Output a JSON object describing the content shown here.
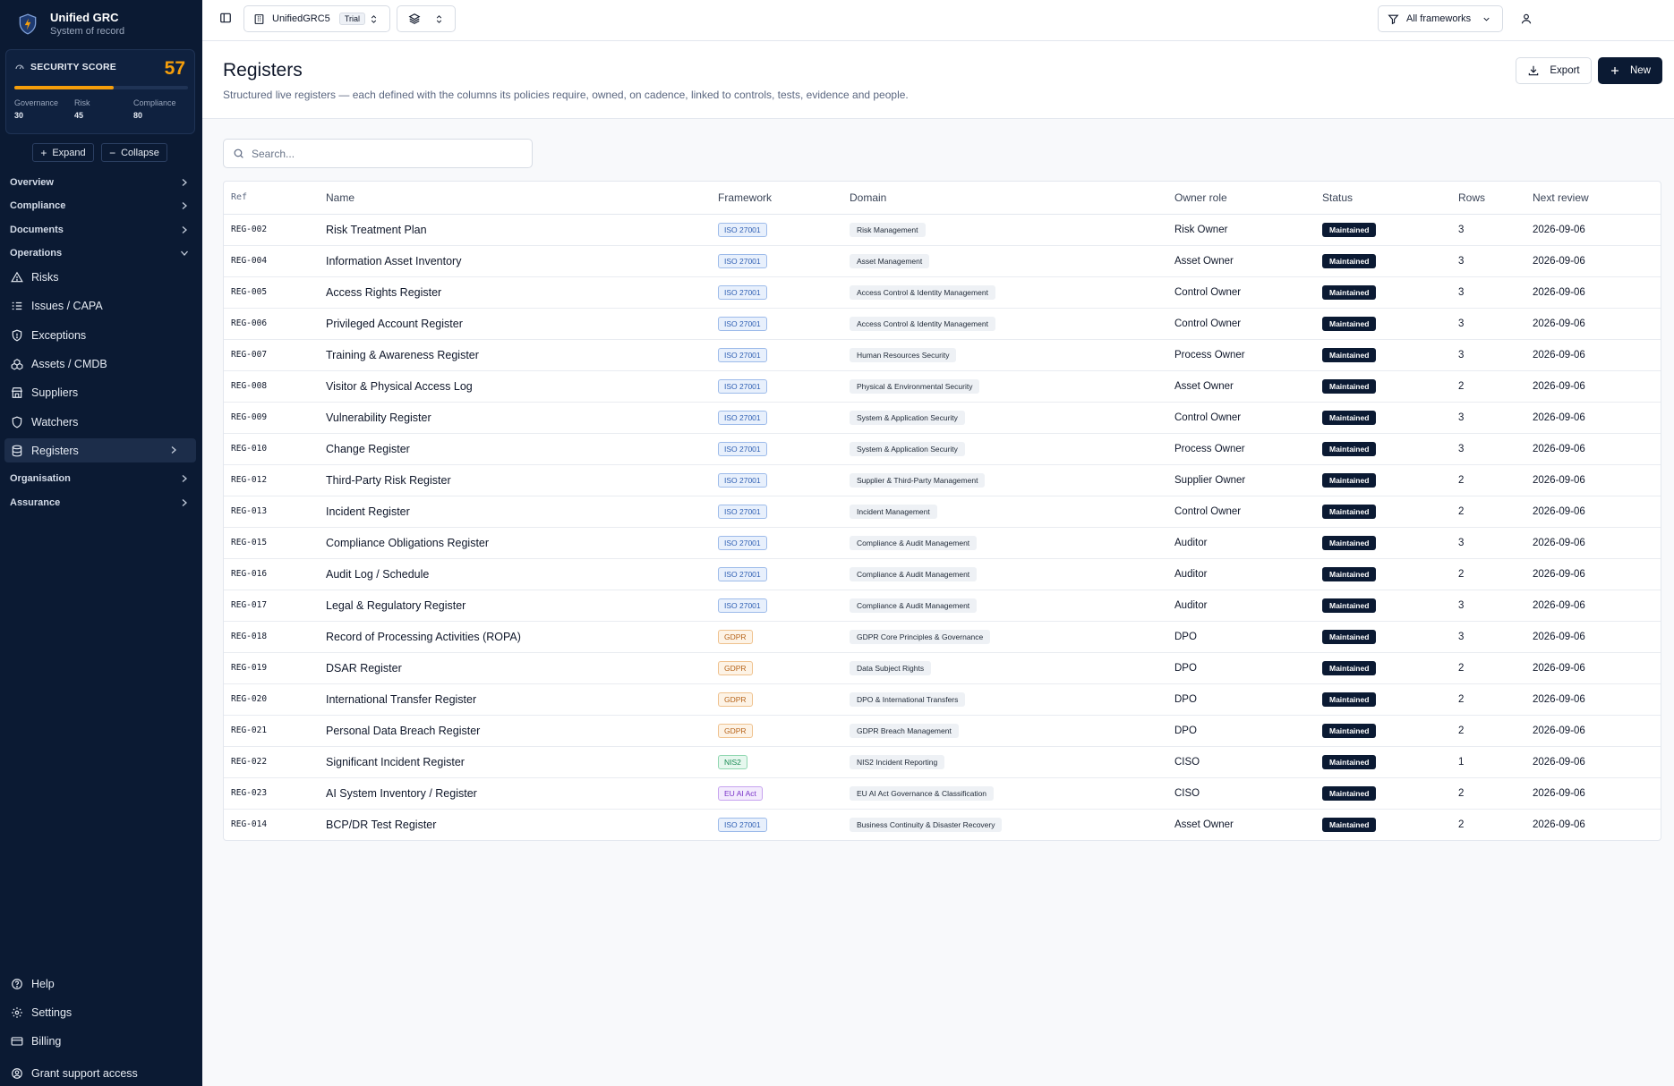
{
  "app": {
    "title": "Unified GRC",
    "subtitle": "System of record"
  },
  "score": {
    "label": "SECURITY SCORE",
    "value": "57",
    "progress_percent": 57,
    "accent_color": "#f59e0b",
    "parts": [
      {
        "label": "Governance",
        "value": "30"
      },
      {
        "label": "Risk",
        "value": "45"
      },
      {
        "label": "Compliance",
        "value": "80"
      }
    ]
  },
  "sidebar": {
    "expand_label": "Expand",
    "collapse_label": "Collapse",
    "groups": [
      {
        "label": "Overview"
      },
      {
        "label": "Compliance"
      },
      {
        "label": "Documents"
      },
      {
        "label": "Operations"
      }
    ],
    "items": [
      {
        "label": "Risks",
        "icon": "warning-icon"
      },
      {
        "label": "Issues / CAPA",
        "icon": "list-checks-icon"
      },
      {
        "label": "Exceptions",
        "icon": "shield-alert-icon"
      },
      {
        "label": "Assets / CMDB",
        "icon": "boxes-icon"
      },
      {
        "label": "Suppliers",
        "icon": "store-icon"
      },
      {
        "label": "Watchers",
        "icon": "shield-icon"
      },
      {
        "label": "Registers",
        "icon": "database-icon"
      }
    ],
    "groups_after": [
      {
        "label": "Organisation"
      },
      {
        "label": "Assurance"
      }
    ],
    "footer": [
      {
        "label": "Help",
        "icon": "help-icon"
      },
      {
        "label": "Settings",
        "icon": "gear-icon"
      },
      {
        "label": "Billing",
        "icon": "credit-card-icon"
      },
      {
        "label": "Grant support access",
        "icon": "user-circle-icon"
      }
    ]
  },
  "topbar": {
    "workspace": "UnifiedGRC5",
    "plan_badge": "Trial",
    "filter_label": "All frameworks"
  },
  "header": {
    "title": "Registers",
    "subtitle": "Structured live registers — each defined with the columns its policies require, owned, on cadence, linked to controls, tests, evidence and people.",
    "export_label": "Export",
    "new_label": "New"
  },
  "search": {
    "placeholder": "Search..."
  },
  "table": {
    "columns": [
      "Ref",
      "Name",
      "Framework",
      "Domain",
      "Owner role",
      "Status",
      "Rows",
      "Next review"
    ],
    "rows": [
      {
        "ref": "REG-002",
        "name": "Risk Treatment Plan",
        "framework": "ISO 27001",
        "fw": "iso",
        "domain": "Risk Management",
        "owner": "Risk Owner",
        "status": "Maintained",
        "rows": "3",
        "review": "2026-09-06"
      },
      {
        "ref": "REG-004",
        "name": "Information Asset Inventory",
        "framework": "ISO 27001",
        "fw": "iso",
        "domain": "Asset Management",
        "owner": "Asset Owner",
        "status": "Maintained",
        "rows": "3",
        "review": "2026-09-06"
      },
      {
        "ref": "REG-005",
        "name": "Access Rights Register",
        "framework": "ISO 27001",
        "fw": "iso",
        "domain": "Access Control & Identity Management",
        "owner": "Control Owner",
        "status": "Maintained",
        "rows": "3",
        "review": "2026-09-06"
      },
      {
        "ref": "REG-006",
        "name": "Privileged Account Register",
        "framework": "ISO 27001",
        "fw": "iso",
        "domain": "Access Control & Identity Management",
        "owner": "Control Owner",
        "status": "Maintained",
        "rows": "3",
        "review": "2026-09-06"
      },
      {
        "ref": "REG-007",
        "name": "Training & Awareness Register",
        "framework": "ISO 27001",
        "fw": "iso",
        "domain": "Human Resources Security",
        "owner": "Process Owner",
        "status": "Maintained",
        "rows": "3",
        "review": "2026-09-06"
      },
      {
        "ref": "REG-008",
        "name": "Visitor & Physical Access Log",
        "framework": "ISO 27001",
        "fw": "iso",
        "domain": "Physical & Environmental Security",
        "owner": "Asset Owner",
        "status": "Maintained",
        "rows": "2",
        "review": "2026-09-06"
      },
      {
        "ref": "REG-009",
        "name": "Vulnerability Register",
        "framework": "ISO 27001",
        "fw": "iso",
        "domain": "System & Application Security",
        "owner": "Control Owner",
        "status": "Maintained",
        "rows": "3",
        "review": "2026-09-06"
      },
      {
        "ref": "REG-010",
        "name": "Change Register",
        "framework": "ISO 27001",
        "fw": "iso",
        "domain": "System & Application Security",
        "owner": "Process Owner",
        "status": "Maintained",
        "rows": "3",
        "review": "2026-09-06"
      },
      {
        "ref": "REG-012",
        "name": "Third-Party Risk Register",
        "framework": "ISO 27001",
        "fw": "iso",
        "domain": "Supplier & Third-Party Management",
        "owner": "Supplier Owner",
        "status": "Maintained",
        "rows": "2",
        "review": "2026-09-06"
      },
      {
        "ref": "REG-013",
        "name": "Incident Register",
        "framework": "ISO 27001",
        "fw": "iso",
        "domain": "Incident Management",
        "owner": "Control Owner",
        "status": "Maintained",
        "rows": "2",
        "review": "2026-09-06"
      },
      {
        "ref": "REG-015",
        "name": "Compliance Obligations Register",
        "framework": "ISO 27001",
        "fw": "iso",
        "domain": "Compliance & Audit Management",
        "owner": "Auditor",
        "status": "Maintained",
        "rows": "3",
        "review": "2026-09-06"
      },
      {
        "ref": "REG-016",
        "name": "Audit Log / Schedule",
        "framework": "ISO 27001",
        "fw": "iso",
        "domain": "Compliance & Audit Management",
        "owner": "Auditor",
        "status": "Maintained",
        "rows": "2",
        "review": "2026-09-06"
      },
      {
        "ref": "REG-017",
        "name": "Legal & Regulatory Register",
        "framework": "ISO 27001",
        "fw": "iso",
        "domain": "Compliance & Audit Management",
        "owner": "Auditor",
        "status": "Maintained",
        "rows": "3",
        "review": "2026-09-06"
      },
      {
        "ref": "REG-018",
        "name": "Record of Processing Activities (ROPA)",
        "framework": "GDPR",
        "fw": "gdpr",
        "domain": "GDPR Core Principles & Governance",
        "owner": "DPO",
        "status": "Maintained",
        "rows": "3",
        "review": "2026-09-06"
      },
      {
        "ref": "REG-019",
        "name": "DSAR Register",
        "framework": "GDPR",
        "fw": "gdpr",
        "domain": "Data Subject Rights",
        "owner": "DPO",
        "status": "Maintained",
        "rows": "2",
        "review": "2026-09-06"
      },
      {
        "ref": "REG-020",
        "name": "International Transfer Register",
        "framework": "GDPR",
        "fw": "gdpr",
        "domain": "DPO & International Transfers",
        "owner": "DPO",
        "status": "Maintained",
        "rows": "2",
        "review": "2026-09-06"
      },
      {
        "ref": "REG-021",
        "name": "Personal Data Breach Register",
        "framework": "GDPR",
        "fw": "gdpr",
        "domain": "GDPR Breach Management",
        "owner": "DPO",
        "status": "Maintained",
        "rows": "2",
        "review": "2026-09-06"
      },
      {
        "ref": "REG-022",
        "name": "Significant Incident Register",
        "framework": "NIS2",
        "fw": "nis2",
        "domain": "NIS2 Incident Reporting",
        "owner": "CISO",
        "status": "Maintained",
        "rows": "1",
        "review": "2026-09-06"
      },
      {
        "ref": "REG-023",
        "name": "AI System Inventory / Register",
        "framework": "EU AI Act",
        "fw": "euai",
        "domain": "EU AI Act Governance & Classification",
        "owner": "CISO",
        "status": "Maintained",
        "rows": "2",
        "review": "2026-09-06"
      },
      {
        "ref": "REG-014",
        "name": "BCP/DR Test Register",
        "framework": "ISO 27001",
        "fw": "iso",
        "domain": "Business Continuity & Disaster Recovery",
        "owner": "Asset Owner",
        "status": "Maintained",
        "rows": "2",
        "review": "2026-09-06"
      }
    ]
  }
}
